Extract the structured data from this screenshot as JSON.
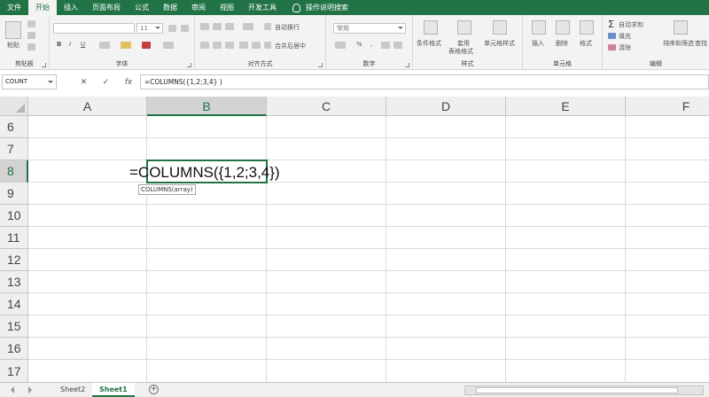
{
  "menu": {
    "tabs": [
      "文件",
      "开始",
      "插入",
      "页面布局",
      "公式",
      "数据",
      "审阅",
      "视图",
      "开发工具"
    ],
    "active_tab": "开始",
    "tell_me": "操作说明搜索"
  },
  "ribbon": {
    "clipboard": {
      "paste": "粘贴",
      "label": "剪贴板"
    },
    "font": {
      "name": "",
      "size": "11",
      "label": "字体"
    },
    "alignment": {
      "wrap_text": "自动换行",
      "merge_center": "合并后居中",
      "label": "对齐方式"
    },
    "number": {
      "format": "常规",
      "label": "数字"
    },
    "styles": {
      "conditional": "条件格式",
      "table": "套用表格格式",
      "cell_styles": "单元格样式",
      "table_line1": "套用",
      "table_line2": "表格格式",
      "label": "样式"
    },
    "cells": {
      "insert": "插入",
      "delete": "删除",
      "format": "格式",
      "label": "单元格"
    },
    "editing": {
      "autosum": "自动求和",
      "fill": "填充",
      "clear": "清除",
      "sort_filter": "排序和筛选",
      "find": "查找",
      "label": "编辑"
    }
  },
  "formula_bar": {
    "name_box": "COUNT",
    "cancel": "✕",
    "enter": "✓",
    "fx": "fx",
    "content": "=COLUMNS({1,2;3,4} )"
  },
  "grid": {
    "columns": [
      "A",
      "B",
      "C",
      "D",
      "E",
      "F"
    ],
    "rows": [
      "6",
      "7",
      "8",
      "9",
      "10",
      "11",
      "12",
      "13",
      "14",
      "15",
      "16",
      "17"
    ],
    "active_cell": {
      "col": "B",
      "row": "8"
    },
    "cell_text": "=COLUMNS({1,2;3,4})",
    "tooltip": "COLUMNS(array)"
  },
  "sheets": {
    "tabs": [
      "Sheet2",
      "Sheet1"
    ],
    "active": "Sheet1",
    "add": "+"
  },
  "colors": {
    "accent": "#217346"
  }
}
